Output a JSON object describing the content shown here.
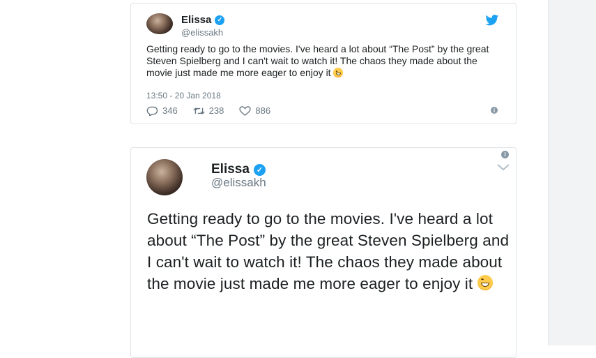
{
  "tweet1": {
    "name": "Elissa",
    "handle": "@elissakh",
    "text": "Getting ready to go to the movies. I've heard a lot about “The Post” by the great Steven Spielberg and I can't wait to watch it! The chaos they made about the movie just made me more eager to enjoy it",
    "timestamp": "13:50 - 20 Jan 2018",
    "replies": "346",
    "retweets": "238",
    "likes": "886",
    "icons": [
      "twitter-bird-icon",
      "verified-icon",
      "reply-icon",
      "retweet-icon",
      "like-icon",
      "info-icon",
      "grinning-emoji-icon"
    ]
  },
  "tweet2": {
    "name": "Elissa",
    "handle": "@elissakh",
    "text": "Getting ready to go to the movies. I've heard a lot about “The Post” by the great Steven Spielberg and I can't wait to watch it! The chaos they made about the movie just made me more eager to enjoy it",
    "icons": [
      "verified-icon",
      "info-icon",
      "chevron-down-icon",
      "grinning-emoji-icon"
    ]
  },
  "colors": {
    "accent": "#1da1f2",
    "text": "#1c2022",
    "muted": "#697882",
    "border": "#dfe3e6",
    "sidebar": "#f2f3f5"
  }
}
